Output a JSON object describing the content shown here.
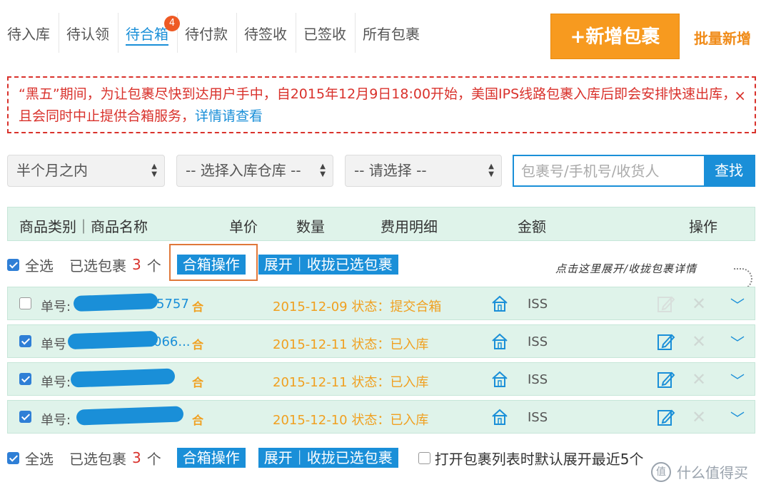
{
  "tabs": [
    {
      "label": "待入库"
    },
    {
      "label": "待认领"
    },
    {
      "label": "待合箱",
      "badge": "4",
      "active": true
    },
    {
      "label": "待付款"
    },
    {
      "label": "待签收"
    },
    {
      "label": "已签收"
    },
    {
      "label": "所有包裹"
    }
  ],
  "header": {
    "add_button": "+新增包裹",
    "batch_link": "批量新增"
  },
  "notice": {
    "text": "“黑五”期间，为让包裹尽快到达用户手中，自2015年12月9日18:00开始，美国IPS线路包裹入库后即会安排快速出库，且会同时中止提供合箱服务，",
    "more_link": "详情请查看",
    "close": "×"
  },
  "filters": {
    "time": "半个月之内",
    "warehouse": "-- 选择入库仓库 --",
    "other": "-- 请选择 --",
    "search_placeholder": "包裹号/手机号/收货人",
    "search_button": "查找"
  },
  "table_header": {
    "category": "商品类别｜商品名称",
    "price": "单价",
    "qty": "数量",
    "fees": "费用明细",
    "amount": "金额",
    "ops": "操作"
  },
  "action_bar": {
    "select_all": "全选",
    "selected_label": "已选包裹",
    "selected_count": "3",
    "unit": "个",
    "merge_button": "合箱操作",
    "toggle_button": "展开｜收拢已选包裹",
    "default_expand": "打开包裹列表时默认展开最近5个"
  },
  "annotation": "点击这里展开/收拢包裹详情",
  "rows": [
    {
      "checked": false,
      "num_label": "单号:",
      "num_tail": "5757",
      "he": "合",
      "status": "2015-12-09 状态：提交合箱",
      "carrier": "ISS",
      "edit_enabled": false
    },
    {
      "checked": true,
      "num_label": "单号",
      "num_tail": "066...",
      "he": "合",
      "status": "2015-12-11 状态：已入库",
      "carrier": "ISS",
      "edit_enabled": true
    },
    {
      "checked": true,
      "num_label": "单号:",
      "num_tail": "",
      "he": "合",
      "status": "2015-12-11 状态：已入库",
      "carrier": "ISS",
      "edit_enabled": true
    },
    {
      "checked": true,
      "num_label": "单号:",
      "num_tail": "",
      "he": "合",
      "status": "2015-12-10 状态：已入库",
      "carrier": "ISS",
      "edit_enabled": true
    }
  ],
  "watermark": "什么值得买",
  "colors": {
    "accent": "#1a8fd8",
    "orange": "#f79a1f",
    "status": "#f0a020",
    "notice": "#d9322c",
    "row_bg": "#dff3ea"
  }
}
